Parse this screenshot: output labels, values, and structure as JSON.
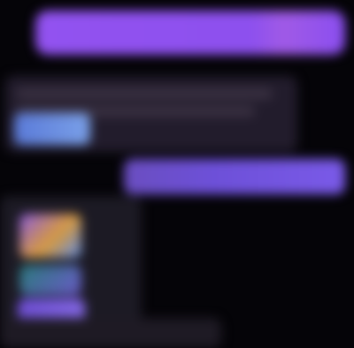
{
  "messages": [
    {
      "direction": "outgoing",
      "text": ""
    },
    {
      "direction": "incoming",
      "text": ""
    },
    {
      "direction": "outgoing",
      "text": ""
    },
    {
      "direction": "incoming",
      "text": ""
    },
    {
      "direction": "incoming",
      "text": ""
    }
  ],
  "colors": {
    "background": "#050408",
    "outgoing_bubble": "#8d50ee",
    "outgoing_bubble_2": "#6d50d8",
    "incoming_bubble": "#221c2c"
  }
}
